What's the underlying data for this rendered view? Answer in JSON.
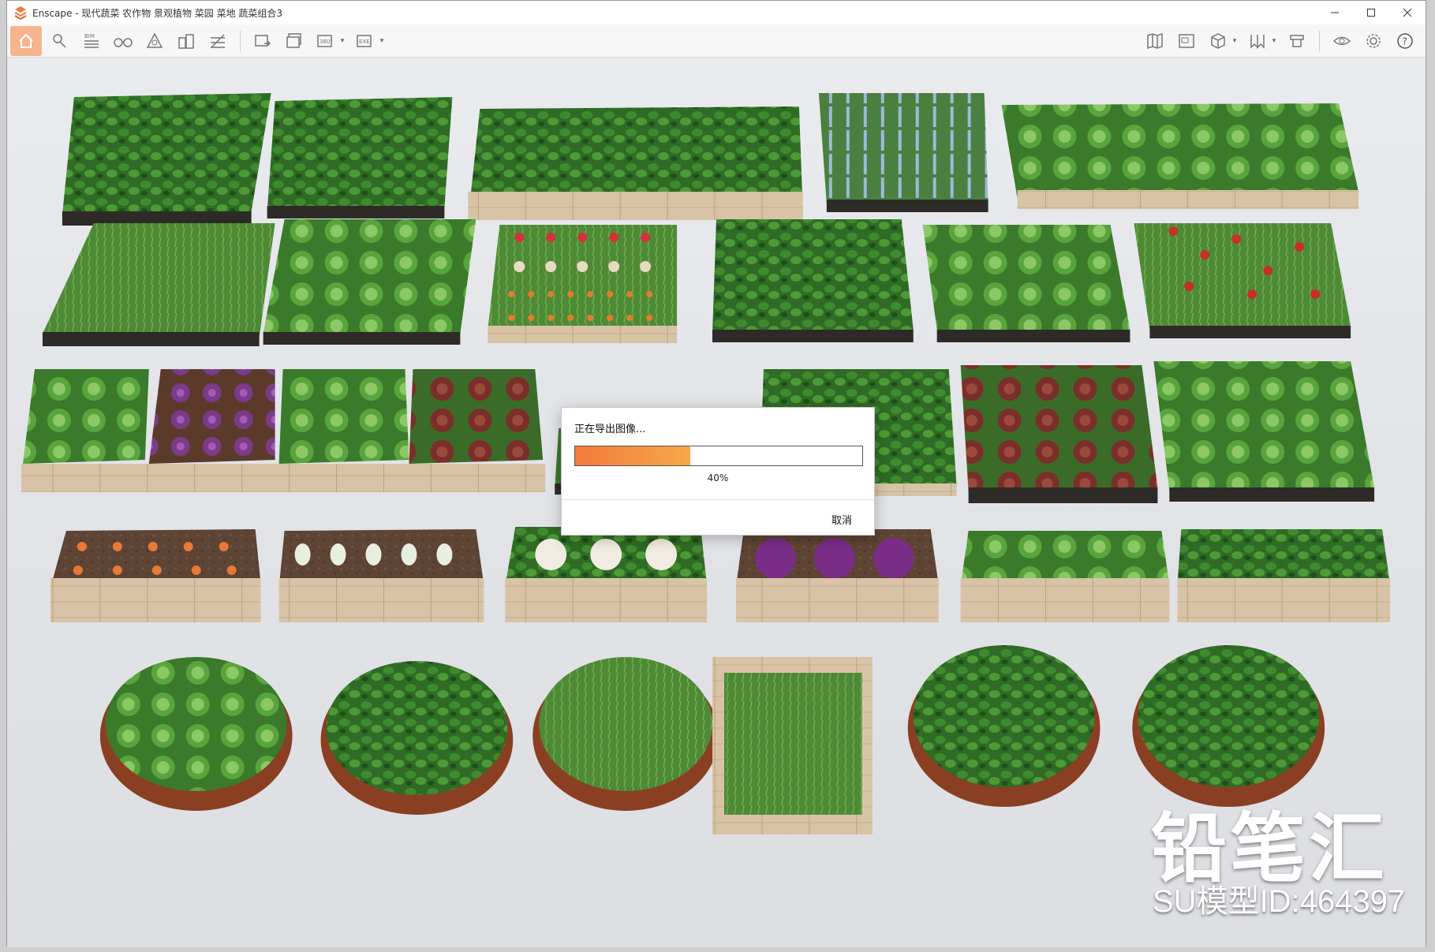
{
  "window": {
    "title": "Enscape - 现代蔬菜 农作物 景观植物 菜园 菜地 蔬菜组合3"
  },
  "toolbar": {
    "bim_label": "BIM",
    "exe_label": "EXE",
    "view_360_label": "360°"
  },
  "dialog": {
    "title": "正在导出图像...",
    "progress_percent": 40,
    "progress_text": "40%",
    "cancel_label": "取消"
  },
  "watermark": {
    "logo_text": "铅笔汇",
    "id_text": "SU模型ID:464397"
  },
  "colors": {
    "accent": "#f47a3a",
    "home_button_bg": "#f6b58f"
  }
}
